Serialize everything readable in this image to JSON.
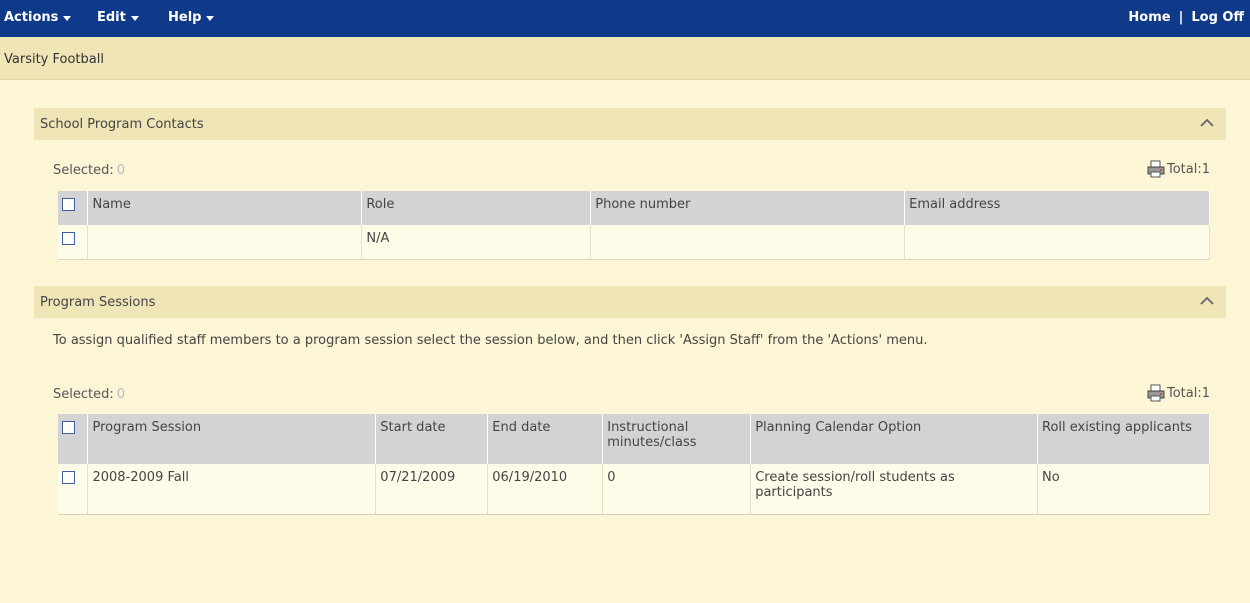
{
  "topbar": {
    "menus": [
      "Actions",
      "Edit",
      "Help"
    ],
    "home": "Home",
    "separator": "|",
    "logoff": "Log Off"
  },
  "breadcrumb": "Varsity Football",
  "contacts": {
    "title": "School Program Contacts",
    "selected_label": "Selected:",
    "selected_count": "0",
    "total_label": "Total:",
    "total_value": "1",
    "columns": [
      "Name",
      "Role",
      "Phone number",
      "Email address"
    ],
    "rows": [
      {
        "name": "",
        "role": "N/A",
        "phone": "",
        "email": ""
      }
    ]
  },
  "sessions": {
    "title": "Program Sessions",
    "description": "To assign qualified staff members to a program session select the session below, and then click 'Assign Staff' from the 'Actions' menu.",
    "selected_label": "Selected:",
    "selected_count": "0",
    "total_label": "Total:",
    "total_value": "1",
    "columns": [
      "Program Session",
      "Start date",
      "End date",
      "Instructional minutes/class",
      "Planning Calendar Option",
      "Roll existing applicants"
    ],
    "rows": [
      {
        "session": "2008-2009 Fall",
        "start": "07/21/2009",
        "end": "06/19/2010",
        "minutes": "0",
        "option": "Create session/roll students as participants",
        "roll": "No"
      }
    ]
  },
  "icons": {
    "collapse": "chevron-up-icon",
    "print": "printer-icon",
    "menu_caret": "caret-down-icon"
  },
  "colors": {
    "topbar": "#0f3a8a",
    "page_bg": "#fdf6d6",
    "section_header": "#efe5b7",
    "table_header": "#d3d3d3"
  }
}
